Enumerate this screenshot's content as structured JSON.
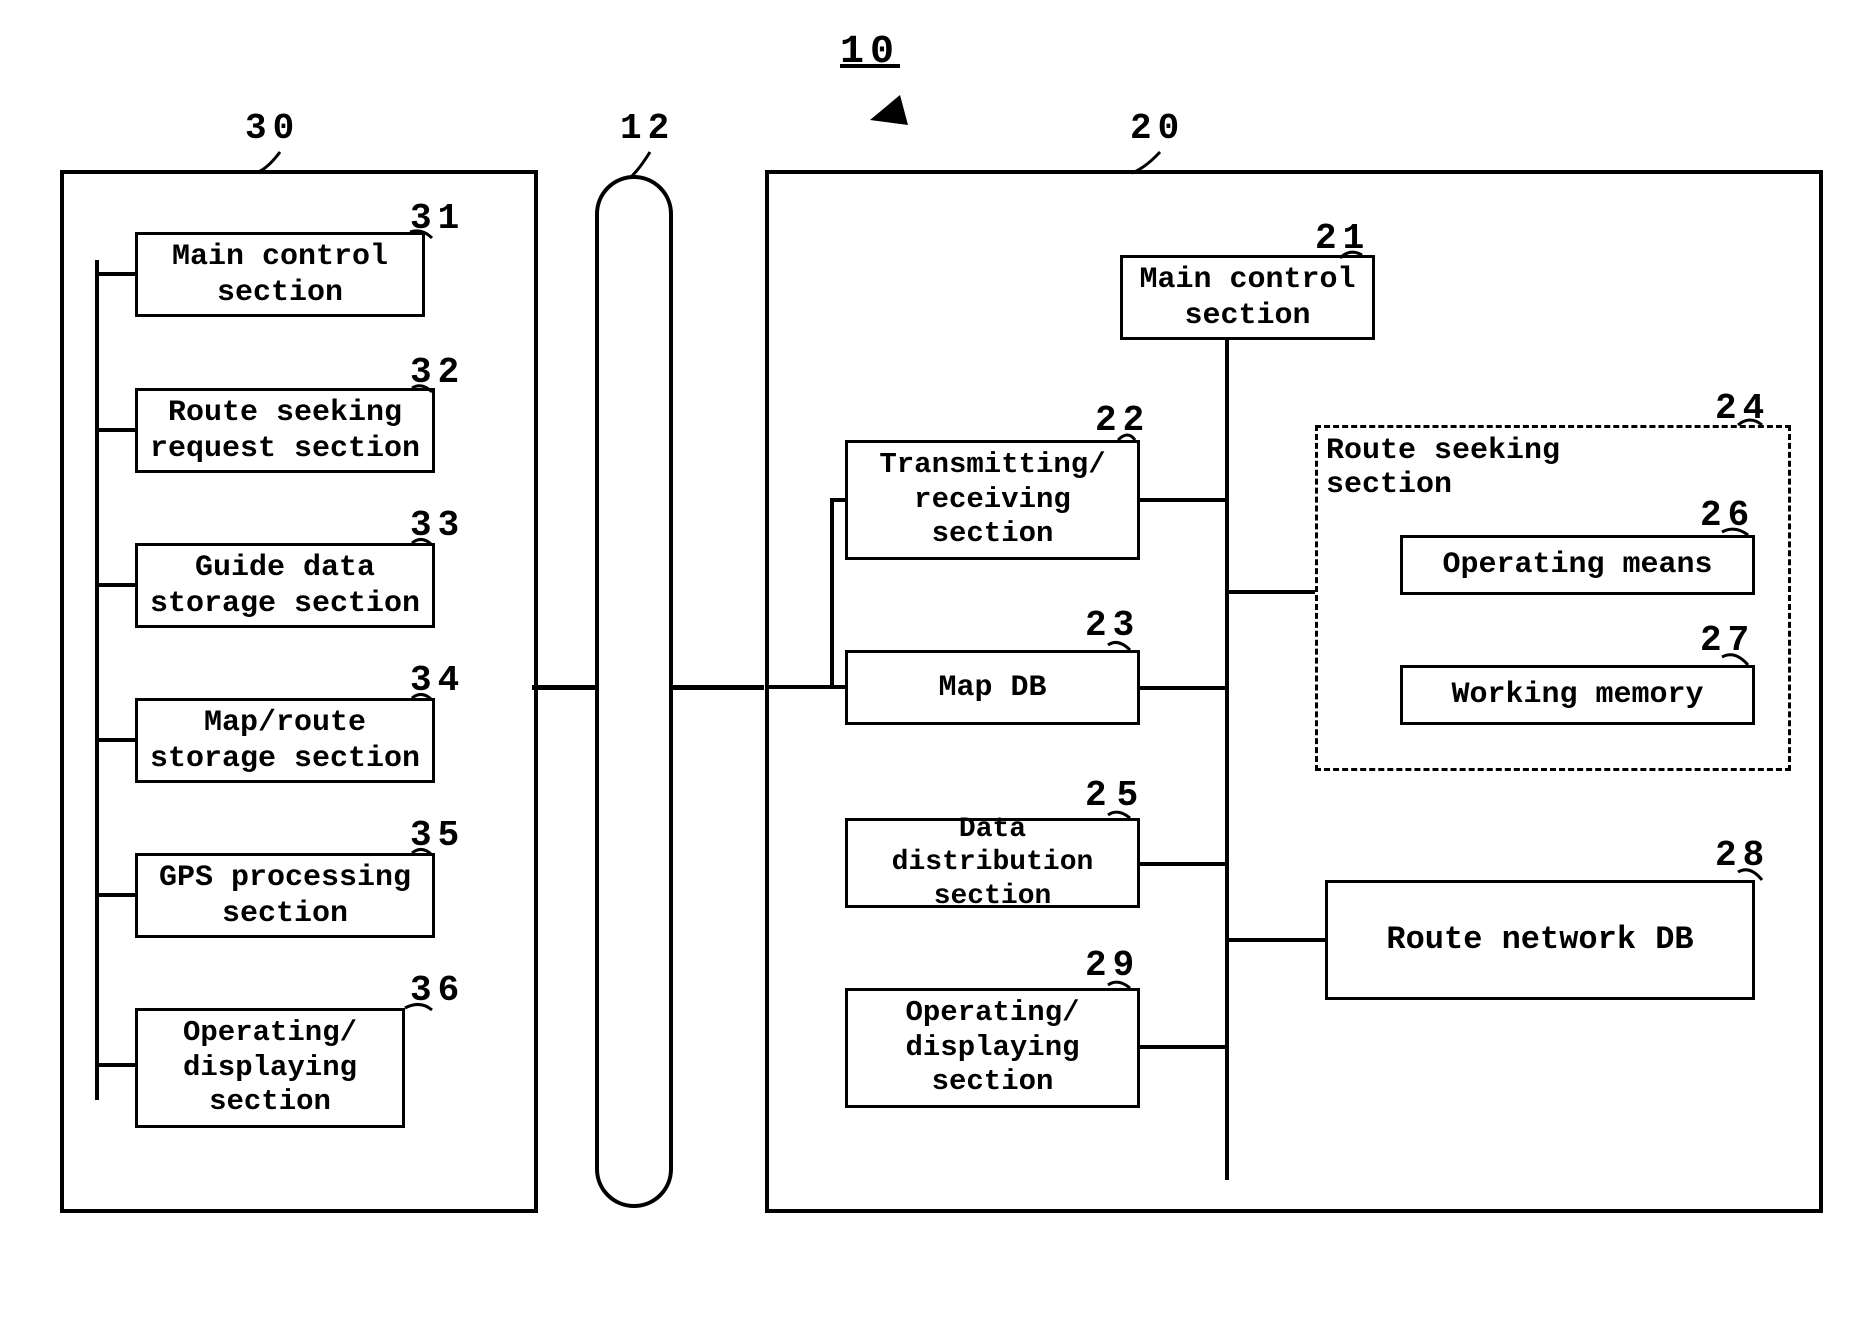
{
  "system_ref": "10",
  "client_ref": "30",
  "network_ref": "12",
  "server_ref": "20",
  "client": {
    "b31": {
      "num": "31",
      "text": "Main control section"
    },
    "b32": {
      "num": "32",
      "text": "Route seeking request section"
    },
    "b33": {
      "num": "33",
      "text": "Guide data storage section"
    },
    "b34": {
      "num": "34",
      "text": "Map/route storage section"
    },
    "b35": {
      "num": "35",
      "text": "GPS processing section"
    },
    "b36": {
      "num": "36",
      "text": "Operating/ displaying section"
    }
  },
  "server": {
    "b21": {
      "num": "21",
      "text": "Main control section"
    },
    "b22": {
      "num": "22",
      "text": "Transmitting/ receiving section"
    },
    "b23": {
      "num": "23",
      "text": "Map DB"
    },
    "b25": {
      "num": "25",
      "text": "Data distribution section"
    },
    "b29": {
      "num": "29",
      "text": "Operating/ displaying section"
    },
    "b24": {
      "num": "24",
      "text": "Route seeking section"
    },
    "b26": {
      "num": "26",
      "text": "Operating means"
    },
    "b27": {
      "num": "27",
      "text": "Working memory"
    },
    "b28": {
      "num": "28",
      "text": "Route network DB"
    }
  }
}
